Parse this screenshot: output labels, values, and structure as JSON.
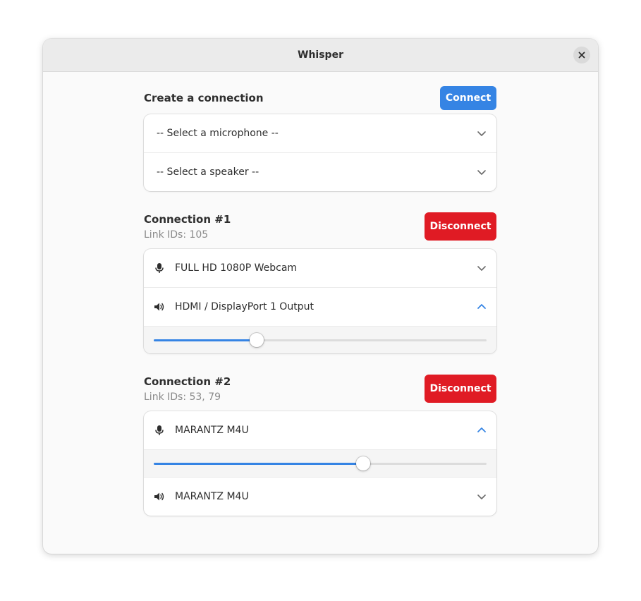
{
  "window": {
    "title": "Whisper"
  },
  "create": {
    "title": "Create a connection",
    "connect_label": "Connect",
    "microphone_placeholder": "-- Select a microphone --",
    "speaker_placeholder": "-- Select a speaker --"
  },
  "connections": [
    {
      "title": "Connection #1",
      "link_ids": "Link IDs: 105",
      "disconnect_label": "Disconnect",
      "microphone": "FULL HD 1080P Webcam",
      "speaker": "HDMI / DisplayPort 1 Output",
      "expanded": "speaker",
      "volume": 0.31
    },
    {
      "title": "Connection #2",
      "link_ids": "Link IDs: 53, 79",
      "disconnect_label": "Disconnect",
      "microphone": "MARANTZ M4U",
      "speaker": "MARANTZ M4U",
      "expanded": "microphone",
      "volume": 0.63
    }
  ],
  "colors": {
    "accent": "#3584e4",
    "destructive": "#e01b24"
  },
  "icons": {
    "microphone": "microphone-icon",
    "speaker": "speaker-icon",
    "chevron_down": "chevron-down-icon",
    "chevron_up": "chevron-up-icon",
    "close": "close-icon"
  }
}
